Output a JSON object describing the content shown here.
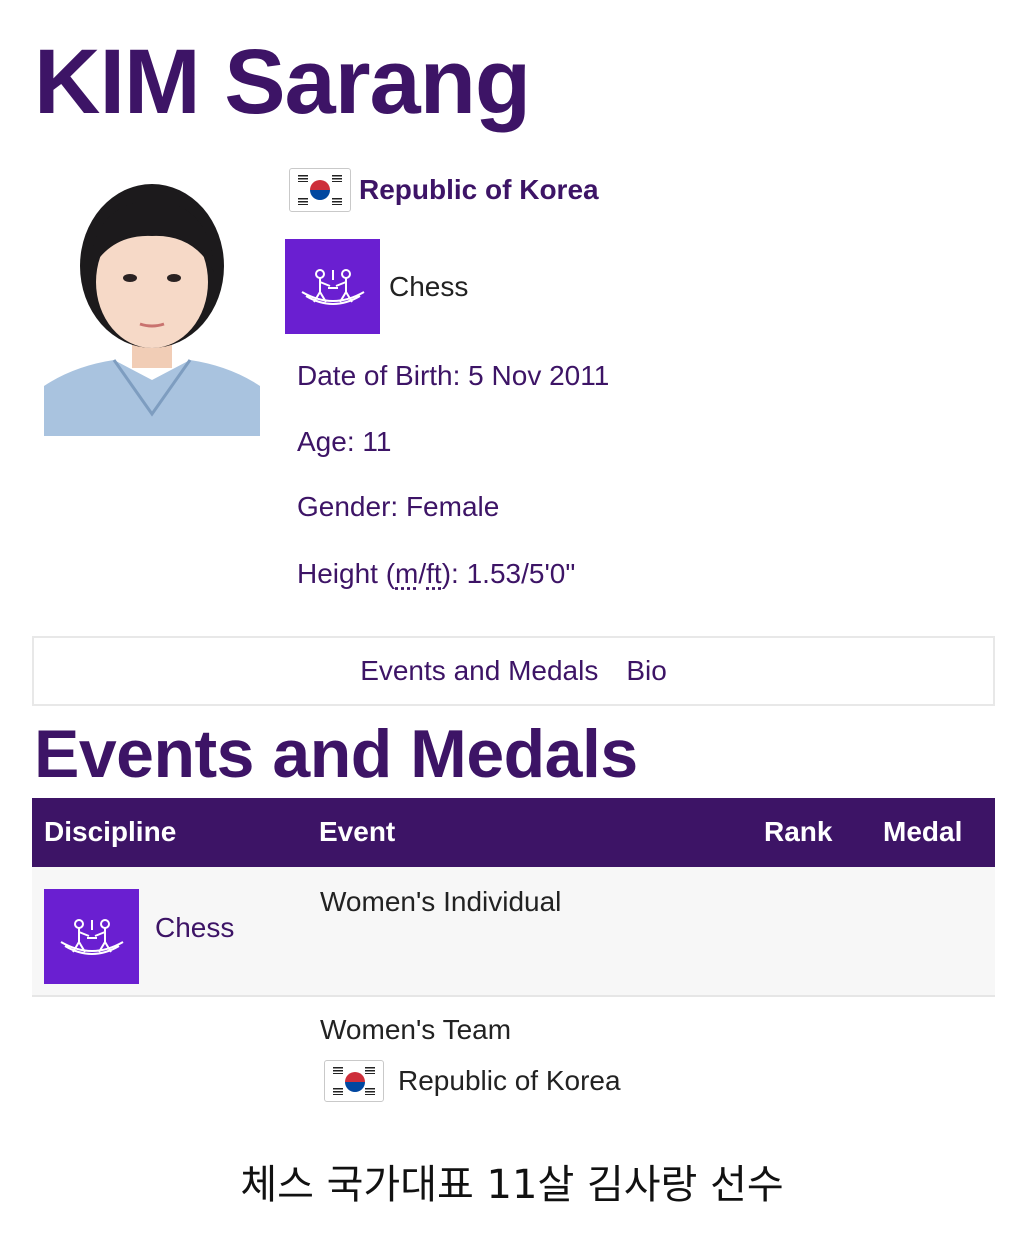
{
  "athlete": {
    "name": "KIM Sarang",
    "country": "Republic of Korea",
    "sport": "Chess",
    "date_of_birth": "Date of Birth: 5 Nov 2011",
    "age": "Age: 11",
    "gender": "Gender: Female",
    "height_prefix": "Height (",
    "height_unit_m": "m",
    "height_sep": "/",
    "height_unit_ft": "ft",
    "height_value": "): 1.53/5'0\""
  },
  "tabs": [
    "Events and Medals",
    "Bio"
  ],
  "section_title": "Events and Medals",
  "table": {
    "headers": {
      "discipline": "Discipline",
      "event": "Event",
      "rank": "Rank",
      "medal": "Medal"
    },
    "rows": [
      {
        "discipline": "Chess",
        "event": "Women's Individual",
        "rank": "",
        "medal": ""
      },
      {
        "discipline": "",
        "event": "Women's Team",
        "team_country": "Republic of Korea",
        "rank": "",
        "medal": ""
      }
    ]
  },
  "caption": "체스 국가대표 11살 김사랑 선수",
  "colors": {
    "brand_purple": "#3d1466",
    "sport_icon_bg": "#6a1fd1"
  },
  "icons": {
    "country_flag": "south-korea-flag-icon",
    "sport": "chess-pictogram-icon"
  }
}
